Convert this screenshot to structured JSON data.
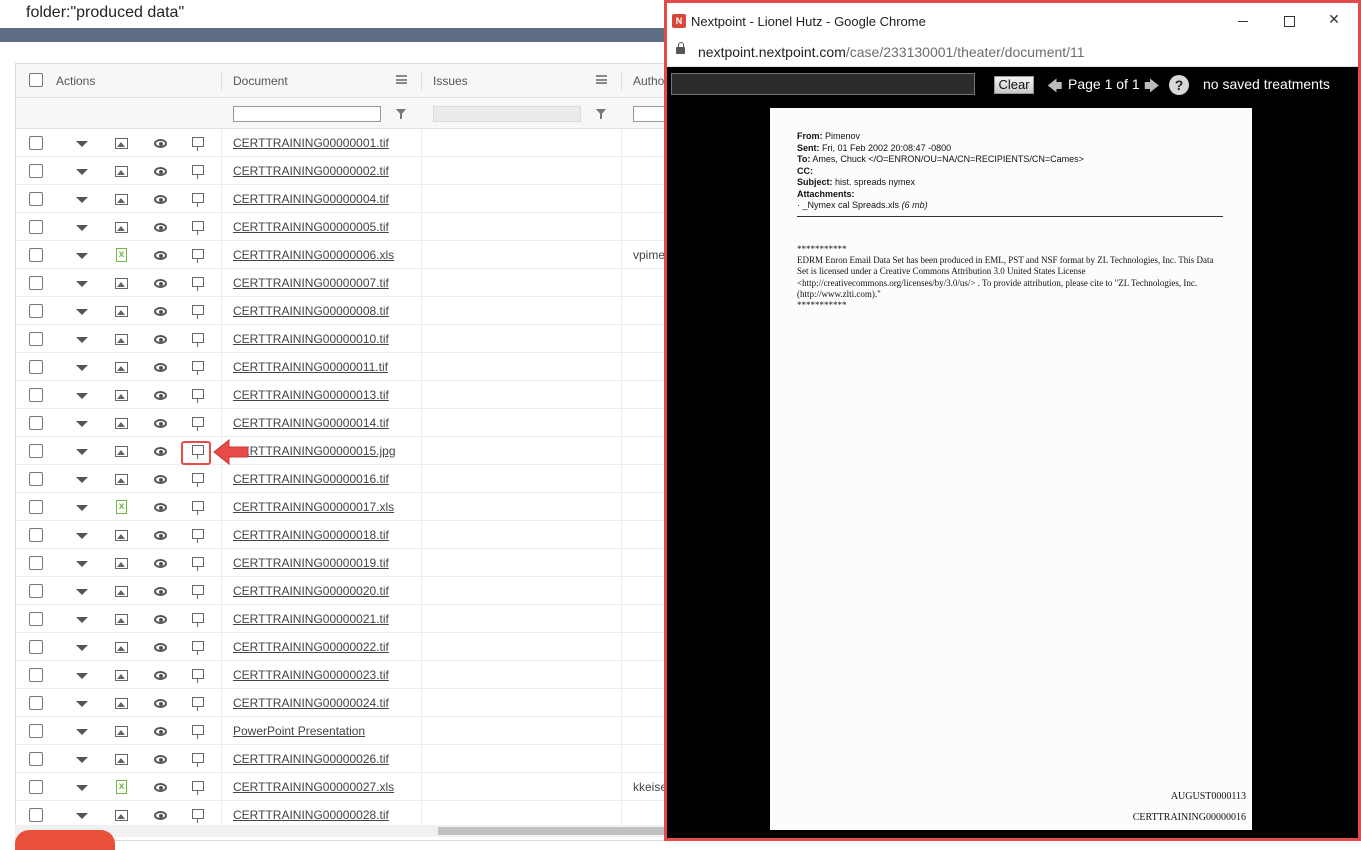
{
  "search": {
    "query": "folder:\"produced data\""
  },
  "grid": {
    "columns": {
      "actions": "Actions",
      "document": "Document",
      "issues": "Issues",
      "author": "Autho"
    },
    "rows": [
      {
        "type": "img",
        "doc": "CERTTRAINING00000001.tif",
        "author": ""
      },
      {
        "type": "img",
        "doc": "CERTTRAINING00000002.tif",
        "author": ""
      },
      {
        "type": "img",
        "doc": "CERTTRAINING00000004.tif",
        "author": ""
      },
      {
        "type": "img",
        "doc": "CERTTRAINING00000005.tif",
        "author": ""
      },
      {
        "type": "xls",
        "doc": "CERTTRAINING00000006.xls",
        "author": "vpime"
      },
      {
        "type": "img",
        "doc": "CERTTRAINING00000007.tif",
        "author": ""
      },
      {
        "type": "img",
        "doc": "CERTTRAINING00000008.tif",
        "author": ""
      },
      {
        "type": "img",
        "doc": "CERTTRAINING00000010.tif",
        "author": ""
      },
      {
        "type": "img",
        "doc": "CERTTRAINING00000011.tif",
        "author": ""
      },
      {
        "type": "img",
        "doc": "CERTTRAINING00000013.tif",
        "author": ""
      },
      {
        "type": "img",
        "doc": "CERTTRAINING00000014.tif",
        "author": ""
      },
      {
        "type": "img",
        "doc": "CERTTRAINING00000015.jpg",
        "author": ""
      },
      {
        "type": "img",
        "doc": "CERTTRAINING00000016.tif",
        "author": ""
      },
      {
        "type": "xls",
        "doc": "CERTTRAINING00000017.xls",
        "author": ""
      },
      {
        "type": "img",
        "doc": "CERTTRAINING00000018.tif",
        "author": ""
      },
      {
        "type": "img",
        "doc": "CERTTRAINING00000019.tif",
        "author": ""
      },
      {
        "type": "img",
        "doc": "CERTTRAINING00000020.tif",
        "author": ""
      },
      {
        "type": "img",
        "doc": "CERTTRAINING00000021.tif",
        "author": ""
      },
      {
        "type": "img",
        "doc": "CERTTRAINING00000022.tif",
        "author": ""
      },
      {
        "type": "img",
        "doc": "CERTTRAINING00000023.tif",
        "author": ""
      },
      {
        "type": "img",
        "doc": "CERTTRAINING00000024.tif",
        "author": ""
      },
      {
        "type": "img",
        "doc": "PowerPoint Presentation",
        "author": ""
      },
      {
        "type": "img",
        "doc": "CERTTRAINING00000026.tif",
        "author": ""
      },
      {
        "type": "xls",
        "doc": "CERTTRAINING00000027.xls",
        "author": "kkeise"
      },
      {
        "type": "img",
        "doc": "CERTTRAINING00000028.tif",
        "author": ""
      }
    ]
  },
  "popup": {
    "title": "Nextpoint - Lionel Hutz - Google Chrome",
    "favicon": "N",
    "url_host": "nextpoint.nextpoint.com",
    "url_path": "/case/233130001/theater/document/11",
    "toolbar": {
      "clear_label": "Clear",
      "page_info": "Page 1 of 1",
      "help": "?",
      "treatments": "no saved treatments"
    },
    "document": {
      "header": [
        {
          "label": "From:",
          "value": " Pimenov"
        },
        {
          "label": "Sent:",
          "value": " Fri, 01 Feb 2002 20:08:47 -0800"
        },
        {
          "label": "To:",
          "value": " Ames, Chuck </O=ENRON/OU=NA/CN=RECIPIENTS/CN=Cames>"
        },
        {
          "label": "CC:",
          "value": ""
        },
        {
          "label": "Subject:",
          "value": " hist. spreads nymex"
        },
        {
          "label": "Attachments:",
          "value": ""
        }
      ],
      "attachment_name": "· _Nymex cal Spreads.xls",
      "attachment_size": "(6 mb)",
      "stars": "***********",
      "body": "EDRM Enron Email Data Set has been produced in EML, PST and NSF format by ZL Technologies, Inc. This Data Set is licensed under a Creative Commons Attribution 3.0 United States License <http://creativecommons.org/licenses/by/3.0/us/> . To provide attribution, please cite to \"ZL Technologies, Inc. (http://www.zlti.com).\"",
      "stars_end": "***********",
      "bates_1": "AUGUST0000113",
      "bates_2": "CERTTRAINING00000016"
    }
  },
  "colors": {
    "accent": "#e34b4b",
    "header_bar": "#5d6e84",
    "xls_green": "#72b840"
  }
}
